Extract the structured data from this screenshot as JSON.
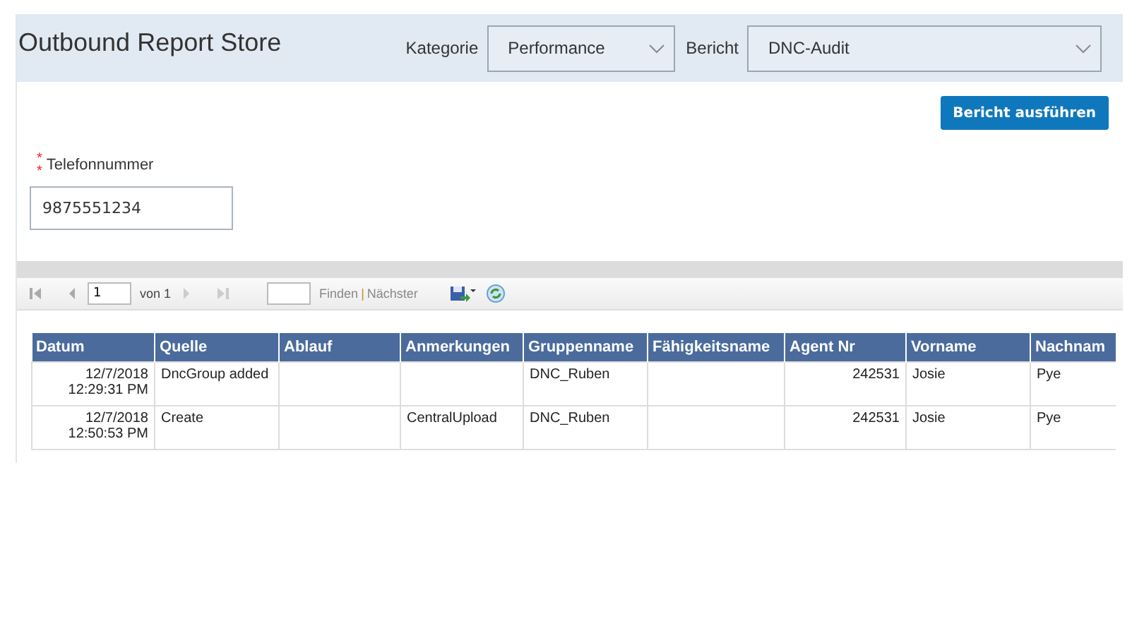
{
  "header": {
    "title": "Outbound Report Store",
    "filters": [
      {
        "label": "Kategorie",
        "value": "Performance"
      },
      {
        "label": "Bericht",
        "value": "DNC-Audit"
      }
    ]
  },
  "run_button": "Bericht ausführen",
  "field": {
    "marks": [
      "*",
      "*"
    ],
    "label": "Telefonnummer",
    "value": "9875551234"
  },
  "toolbar": {
    "page": "1",
    "of": "von 1",
    "find": "Finden",
    "separator": "|",
    "next": "Nächster"
  },
  "table": {
    "columns": [
      "Datum",
      "Quelle",
      "Ablauf",
      "Anmerkungen",
      "Gruppenname",
      "Fähigkeitsname",
      "Agent Nr",
      "Vorname",
      "Nachnam"
    ],
    "rows": [
      {
        "cells": [
          [
            "12/7/2018",
            "12:29:31 PM"
          ],
          [
            "DncGroup added"
          ],
          [],
          [],
          [
            "DNC_Ruben"
          ],
          [],
          [
            "242531"
          ],
          [
            "Josie"
          ],
          [
            "Pye"
          ]
        ]
      },
      {
        "cells": [
          [
            "12/7/2018",
            "12:50:53 PM"
          ],
          [
            "Create"
          ],
          [],
          [
            "CentralUpload"
          ],
          [
            "DNC_Ruben"
          ],
          [],
          [
            "242531"
          ],
          [
            "Josie"
          ],
          [
            "Pye"
          ]
        ]
      }
    ]
  }
}
